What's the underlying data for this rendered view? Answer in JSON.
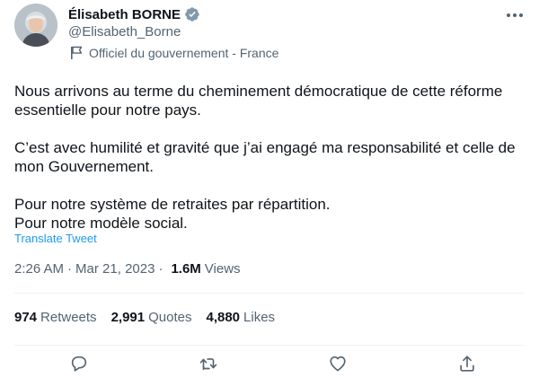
{
  "author": {
    "display_name": "Élisabeth BORNE",
    "handle": "@Elisabeth_Borne",
    "affiliation": "Officiel du gouvernement - France",
    "verified_color": "#829aab"
  },
  "tweet": {
    "paragraphs": [
      "Nous arrivons au terme du cheminement démocratique de cette réforme essentielle pour notre pays.",
      "C’est avec humilité et gravité que j’ai engagé ma responsabilité et celle de mon Gouvernement."
    ],
    "closing_lines": [
      "Pour notre système de retraites par répartition.",
      "Pour notre modèle social."
    ],
    "translate_label": "Translate Tweet",
    "time": "2:26 AM",
    "separator": "·",
    "date": "Mar 21, 2023",
    "views_count": "1.6M",
    "views_label": "Views"
  },
  "stats": {
    "retweets_count": "974",
    "retweets_label": "Retweets",
    "quotes_count": "2,991",
    "quotes_label": "Quotes",
    "likes_count": "4,880",
    "likes_label": "Likes"
  },
  "icons": {
    "more": "more-horizontal-icon",
    "verified": "verified-badge-icon",
    "affiliation": "government-flag-icon",
    "reply": "reply-icon",
    "retweet": "retweet-icon",
    "like": "heart-icon",
    "share": "share-icon"
  },
  "colors": {
    "link": "#1d9bf0",
    "secondary_text": "#536471",
    "primary_text": "#0f1419",
    "divider": "#eff3f4"
  }
}
